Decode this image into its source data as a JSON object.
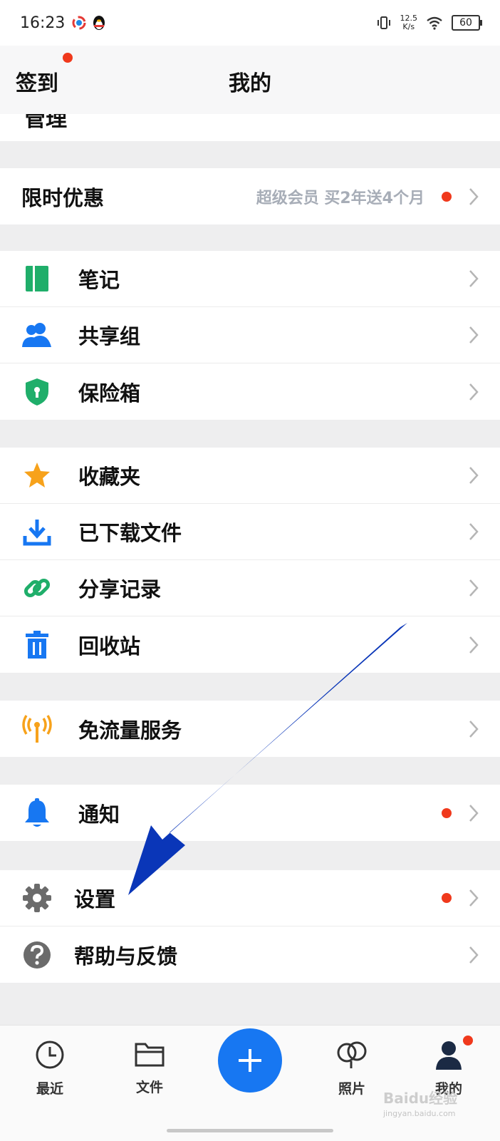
{
  "status_bar": {
    "time": "16:23",
    "net_speed_value": "12.5",
    "net_speed_unit": "K/s",
    "battery": "60"
  },
  "header": {
    "checkin_label": "签到",
    "title": "我的"
  },
  "partial_row_label": "管理",
  "promo": {
    "label": "限时优惠",
    "detail": "超级会员 买2年送4个月"
  },
  "group1": [
    {
      "label": "笔记",
      "icon": "notebook-icon"
    },
    {
      "label": "共享组",
      "icon": "users-icon"
    },
    {
      "label": "保险箱",
      "icon": "shield-lock-icon"
    }
  ],
  "group2": [
    {
      "label": "收藏夹",
      "icon": "star-icon"
    },
    {
      "label": "已下载文件",
      "icon": "download-icon"
    },
    {
      "label": "分享记录",
      "icon": "link-icon"
    },
    {
      "label": "回收站",
      "icon": "trash-icon"
    }
  ],
  "group3": [
    {
      "label": "免流量服务",
      "icon": "signal-tower-icon"
    }
  ],
  "group4": [
    {
      "label": "通知",
      "icon": "bell-icon"
    }
  ],
  "group5": [
    {
      "label": "设置",
      "icon": "gear-icon"
    },
    {
      "label": "帮助与反馈",
      "icon": "help-icon"
    }
  ],
  "tabs": [
    {
      "label": "最近",
      "icon": "clock-icon"
    },
    {
      "label": "文件",
      "icon": "folder-icon"
    },
    {
      "label": "",
      "icon": "plus-icon"
    },
    {
      "label": "照片",
      "icon": "balloon-icon"
    },
    {
      "label": "我的",
      "icon": "user-icon"
    }
  ],
  "watermark": {
    "brand": "Baidu经验",
    "url": "jingyan.baidu.com"
  },
  "colors": {
    "accent_blue": "#1777f2",
    "badge_red": "#f0391c",
    "green": "#1fae6a",
    "star_orange": "#f7a21b",
    "arrow_blue": "#0a36b8"
  }
}
